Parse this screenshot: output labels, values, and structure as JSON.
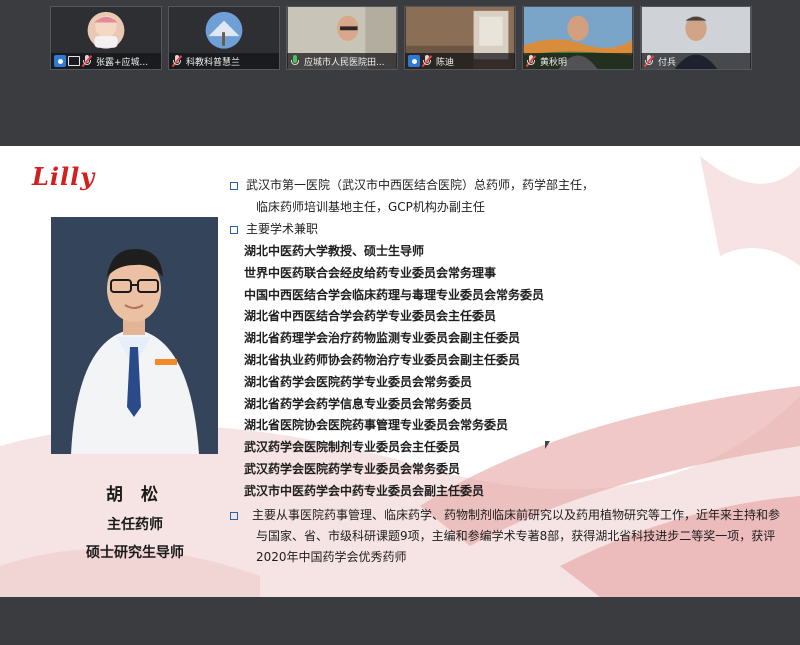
{
  "participants": [
    {
      "name": "张露+应城...",
      "host": true,
      "sharing": true,
      "mic_muted": true,
      "avatar": "baby-photo"
    },
    {
      "name": "科教科普慧兰",
      "host": false,
      "sharing": false,
      "mic_muted": true,
      "avatar": "tree-photo"
    },
    {
      "name": "应城市人民医院田...",
      "host": false,
      "sharing": false,
      "mic_muted": false,
      "avatar": "video"
    },
    {
      "name": "陈迪",
      "host": true,
      "sharing": false,
      "mic_muted": true,
      "avatar": "video"
    },
    {
      "name": "黄秋明",
      "host": false,
      "sharing": false,
      "mic_muted": true,
      "avatar": "video"
    },
    {
      "name": "付兵",
      "host": false,
      "sharing": false,
      "mic_muted": true,
      "avatar": "video"
    }
  ],
  "slide": {
    "logo": "Lilly",
    "person_name": "胡 松",
    "person_title": "主任药师",
    "person_role": "硕士研究生导师",
    "bullet1_line1": "武汉市第一医院（武汉市中西医结合医院）总药师，药学部主任，",
    "bullet1_line2": "临床药师培训基地主任，GCP机构办副主任",
    "bullet2_heading": "主要学术兼职",
    "credentials": [
      "湖北中医药大学教授、硕士生导师",
      "世界中医药联合会经皮给药专业委员会常务理事",
      "中国中西医结合学会临床药理与毒理专业委员会常务委员",
      "湖北省中西医结合学会药学专业委员会主任委员",
      "湖北省药理学会治疗药物监测专业委员会副主任委员",
      "湖北省执业药师协会药物治疗专业委员会副主任委员",
      "湖北省药学会医院药学专业委员会常务委员",
      "湖北省药学会药学信息专业委员会常务委员",
      "湖北省医院协会医院药事管理专业委员会常务委员",
      "武汉药学会医院制剂专业委员会主任委员",
      "武汉药学会医院药学专业委员会常务委员",
      "武汉市中医药学会中药专业委员会副主任委员"
    ],
    "bullet3": "主要从事医院药事管理、临床药学、药物制剂临床前研究以及药用植物研究等工作，近年来主持和参与国家、省、市级科研课题9项，主编和参编学术专著8部，获得湖北省科技进步二等奖一项，获评2020年中国药学会优秀药师"
  },
  "colors": {
    "app_bg": "#3b3c3f",
    "logo_red": "#d41f1f",
    "bullet_blue": "#2a64a8",
    "swoosh_red": "#e8a6a6"
  }
}
